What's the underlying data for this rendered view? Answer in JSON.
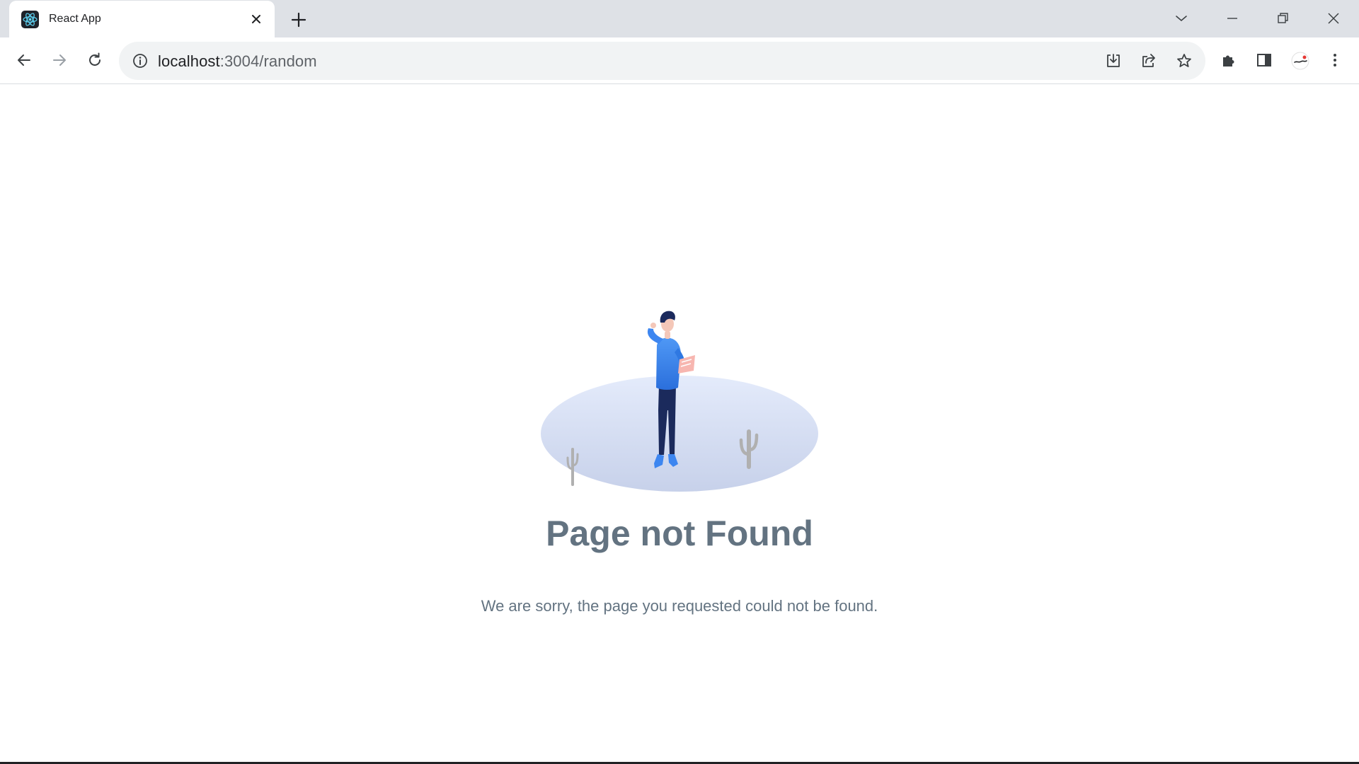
{
  "browser": {
    "tab": {
      "title": "React App",
      "favicon": "react-logo-icon"
    },
    "address_bar": {
      "host": "localhost",
      "path": ":3004/random"
    },
    "colors": {
      "tabstrip": "#dee1e6",
      "omnibox": "#f1f3f4",
      "react_accent": "#61dafb"
    }
  },
  "page": {
    "title": "Page not Found",
    "message": "We are sorry, the page you requested could not be found.",
    "illustration": "person-standing-on-island-with-cacti",
    "colors": {
      "text": "#637381",
      "shirt": "#3d86f0",
      "pants": "#1b2a5c",
      "island": "#d3dcf3",
      "cactus": "#b0b0b0"
    }
  }
}
